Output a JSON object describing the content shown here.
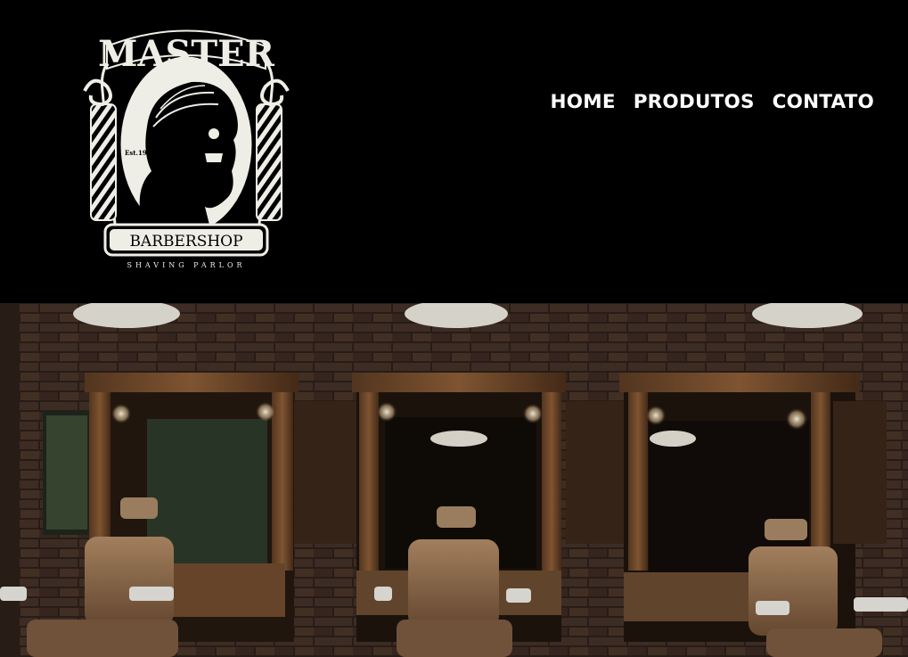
{
  "logo": {
    "top_text": "MASTER",
    "est_text": "Est.1990",
    "banner_text": "BARBERSHOP",
    "sub_text": "SHAVING PARLOR"
  },
  "nav": {
    "items": [
      {
        "label": "HOME"
      },
      {
        "label": "PRODUTOS"
      },
      {
        "label": "CONTATO"
      }
    ]
  },
  "colors": {
    "header_bg": "#000000",
    "nav_text": "#ffffff",
    "logo_cream": "#efeee6"
  }
}
